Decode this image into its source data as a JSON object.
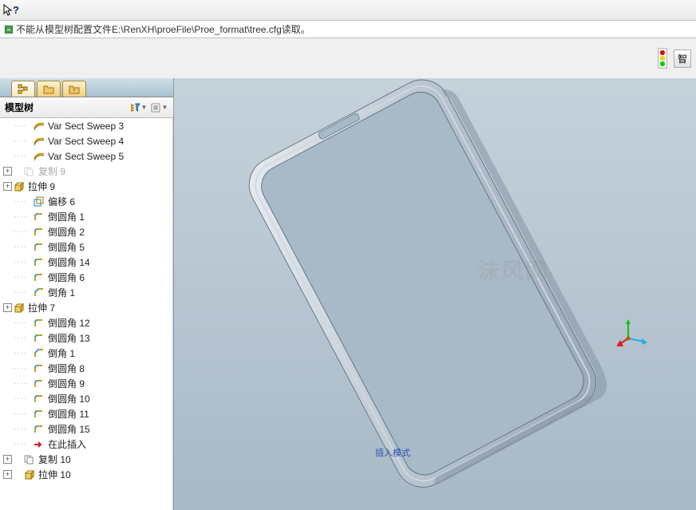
{
  "toolbar": {
    "help_hint": "?"
  },
  "message_bar": {
    "text": "不能从模型树配置文件E:\\RenXH\\proeFile\\Proe_format\\tree.cfg读取。"
  },
  "right_button": "智",
  "panel": {
    "title": "模型树"
  },
  "tree": {
    "items": [
      {
        "type": "sweep",
        "label": "Var Sect Sweep 3",
        "expand": null,
        "indent": 2
      },
      {
        "type": "sweep",
        "label": "Var Sect Sweep 4",
        "expand": null,
        "indent": 2
      },
      {
        "type": "sweep",
        "label": "Var Sect Sweep 5",
        "expand": null,
        "indent": 2
      },
      {
        "type": "copy",
        "label": "复制 9",
        "expand": "closed",
        "indent": 1,
        "disabled": true
      },
      {
        "type": "extrude",
        "label": "拉伸 9",
        "expand": "closed",
        "indent": 1,
        "plus": true
      },
      {
        "type": "offset",
        "label": "偏移 6",
        "expand": null,
        "indent": 2
      },
      {
        "type": "round",
        "label": "倒圆角 1",
        "expand": null,
        "indent": 2
      },
      {
        "type": "round",
        "label": "倒圆角 2",
        "expand": null,
        "indent": 2
      },
      {
        "type": "round",
        "label": "倒圆角 5",
        "expand": null,
        "indent": 2
      },
      {
        "type": "round",
        "label": "倒圆角 14",
        "expand": null,
        "indent": 2
      },
      {
        "type": "round",
        "label": "倒圆角 6",
        "expand": null,
        "indent": 2
      },
      {
        "type": "chamfer",
        "label": "倒角 1",
        "expand": null,
        "indent": 2
      },
      {
        "type": "extrude",
        "label": "拉伸 7",
        "expand": "closed",
        "indent": 1,
        "plus": true
      },
      {
        "type": "round",
        "label": "倒圆角 12",
        "expand": null,
        "indent": 2
      },
      {
        "type": "round",
        "label": "倒圆角 13",
        "expand": null,
        "indent": 2
      },
      {
        "type": "chamfer",
        "label": "倒角 1",
        "expand": null,
        "indent": 2
      },
      {
        "type": "round",
        "label": "倒圆角 8",
        "expand": null,
        "indent": 2
      },
      {
        "type": "round",
        "label": "倒圆角 9",
        "expand": null,
        "indent": 2
      },
      {
        "type": "round",
        "label": "倒圆角 10",
        "expand": null,
        "indent": 2
      },
      {
        "type": "round",
        "label": "倒圆角 11",
        "expand": null,
        "indent": 2
      },
      {
        "type": "round",
        "label": "倒圆角 15",
        "expand": null,
        "indent": 2
      },
      {
        "type": "insert",
        "label": "在此插入",
        "expand": null,
        "indent": 2
      },
      {
        "type": "copy",
        "label": "复制 10",
        "expand": "closed",
        "indent": 1
      },
      {
        "type": "extrude",
        "label": "拉伸 10",
        "expand": "closed",
        "indent": 1
      }
    ]
  },
  "viewport": {
    "mode_label": "插入模式",
    "watermark": "沫风网"
  }
}
